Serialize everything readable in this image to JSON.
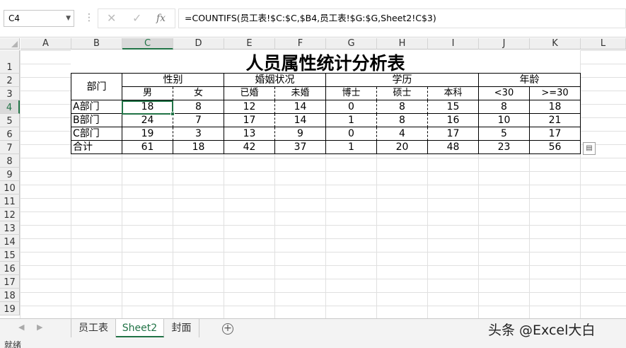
{
  "formula_bar": {
    "name_box": "C4",
    "formula": "=COUNTIFS(员工表!$C:$C,$B4,员工表!$G:$G,Sheet2!C$3)",
    "cancel_icon": "✕",
    "enter_icon": "✓",
    "fx_label": "fx"
  },
  "columns": [
    "A",
    "B",
    "C",
    "D",
    "E",
    "F",
    "G",
    "H",
    "I",
    "J",
    "K",
    "L"
  ],
  "rows": [
    "1",
    "2",
    "3",
    "4",
    "5",
    "6",
    "7",
    "8",
    "9",
    "10",
    "11",
    "12",
    "13",
    "14",
    "15",
    "16",
    "17",
    "18",
    "19"
  ],
  "sheet": {
    "title": "人员属性统计分析表",
    "dept_header": "部门",
    "groups": {
      "gender": "性别",
      "marital": "婚姻状况",
      "education": "学历",
      "age": "年龄"
    },
    "subheaders": [
      "男",
      "女",
      "已婚",
      "未婚",
      "博士",
      "硕士",
      "本科",
      "<30",
      ">=30"
    ],
    "data_rows": [
      {
        "label": "A部门",
        "values": [
          "18",
          "8",
          "12",
          "14",
          "0",
          "8",
          "15",
          "8",
          "18"
        ]
      },
      {
        "label": "B部门",
        "values": [
          "24",
          "7",
          "17",
          "14",
          "1",
          "8",
          "16",
          "10",
          "21"
        ]
      },
      {
        "label": "C部门",
        "values": [
          "19",
          "3",
          "13",
          "9",
          "0",
          "4",
          "17",
          "5",
          "17"
        ]
      }
    ],
    "total_row": {
      "label": "合计",
      "values": [
        "61",
        "18",
        "42",
        "37",
        "1",
        "20",
        "48",
        "23",
        "56"
      ]
    }
  },
  "tabs": {
    "t1": "员工表",
    "t2": "Sheet2",
    "t3": "封面"
  },
  "status": "就绪",
  "watermark": "头条 @Excel大白",
  "accent_color": "#217346"
}
